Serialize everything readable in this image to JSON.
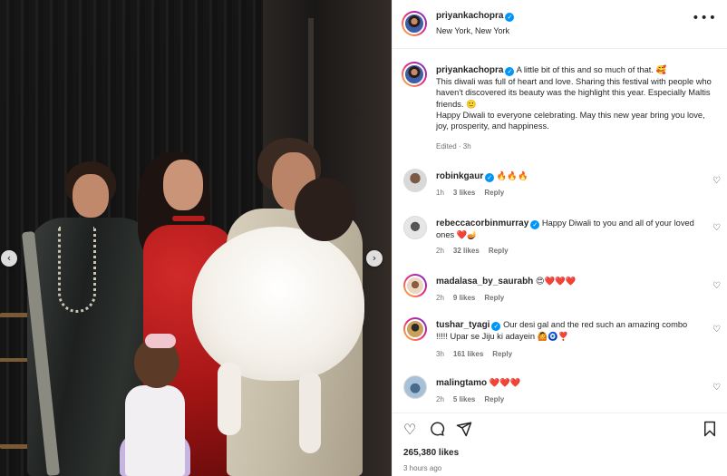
{
  "post": {
    "username": "priyankachopra",
    "location": "New York, New York",
    "more_label": "•••",
    "verified_label": "✓"
  },
  "caption": {
    "username": "priyankachopra",
    "text": "A little bit of this and so much of that. 🥰\nThis diwali was full of heart and love. Sharing this festival with people who haven't discovered its beauty was the highlight this year. Especially Maltis friends. 🙂\nHappy Diwali to everyone celebrating. May this new year bring you love, joy, prosperity, and happiness.",
    "meta": "Edited · 3h"
  },
  "comments": [
    {
      "username": "robinkgaur",
      "verified": true,
      "text": "🔥🔥🔥",
      "time": "1h",
      "likes": "3 likes",
      "reply": "Reply"
    },
    {
      "username": "rebeccacorbinmurray",
      "verified": true,
      "text": "Happy Diwali to you and all of your loved ones ❤️🪔",
      "time": "2h",
      "likes": "32 likes",
      "reply": "Reply"
    },
    {
      "username": "madalasa_by_saurabh",
      "verified": false,
      "text": "😍❤️❤️❤️",
      "time": "2h",
      "likes": "9 likes",
      "reply": "Reply"
    },
    {
      "username": "tushar_tyagi",
      "verified": true,
      "text": "Our desi gal and the red such an amazing combo !!!!! Upar se Jiju ki adayein 🙆🧿❣️",
      "time": "3h",
      "likes": "161 likes",
      "reply": "Reply"
    },
    {
      "username": "malingtamo",
      "verified": false,
      "text": "❤️❤️❤️",
      "time": "2h",
      "likes": "5 likes",
      "reply": "Reply"
    }
  ],
  "footer": {
    "likes": "265,380 likes",
    "ago": "3 hours ago"
  },
  "icons": {
    "like": "heart-icon",
    "comment": "comment-icon",
    "share": "share-icon",
    "save": "bookmark-icon",
    "prev": "chevron-left-icon",
    "next": "chevron-right-icon"
  },
  "colors": {
    "verified": "#0095f6",
    "muted": "#737373",
    "heart": "#e0245e"
  }
}
